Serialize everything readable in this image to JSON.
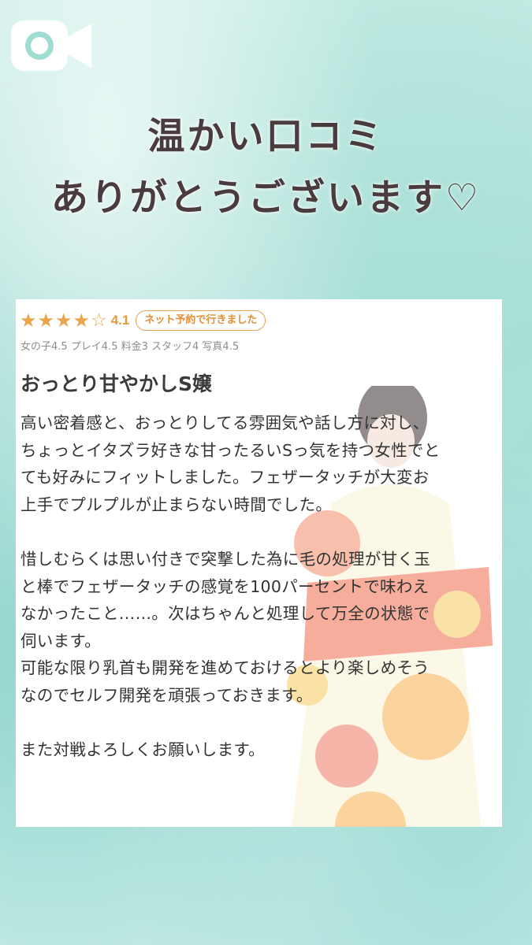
{
  "icons": {
    "top_left": "video-camera-icon"
  },
  "headline": {
    "line1": "温かい口コミ",
    "line2": "ありがとうございます♡"
  },
  "review": {
    "rating_value": "4.1",
    "stars_full": 4,
    "stars_total": 5,
    "badge": "ネット予約で行きました",
    "scores": "女の子4.5 プレイ4.5 料金3 スタッフ4 写真4.5",
    "title": "おっとり甘やかしS嬢",
    "body_lines": {
      "l1": "高い密着感と、おっとりしてる雰囲気や話し方に対し、",
      "l2": "ちょっとイタズラ好きな甘ったるいSっ気を持つ女性でと",
      "l3": "ても好みにフィットしました。フェザータッチが大変お",
      "l4": "上手でプルプルが止まらない時間でした。",
      "l5": "惜しむらくは思い付きで突撃した為に毛の処理が甘く玉",
      "l6": "と棒でフェザータッチの感覚を100パーセントで味わえ",
      "l7": "なかったこと……。次はちゃんと処理して万全の状態で",
      "l8": "伺います。",
      "l9": "可能な限り乳首も開発を進めておけるとより楽しめそう",
      "l10": "なのでセルフ開発を頑張っておきます。",
      "l11": "また対戦よろしくお願いします。"
    }
  },
  "colors": {
    "star": "#e9a54a",
    "badge_border": "#e0a25b",
    "headline": "#4a3b3f"
  }
}
